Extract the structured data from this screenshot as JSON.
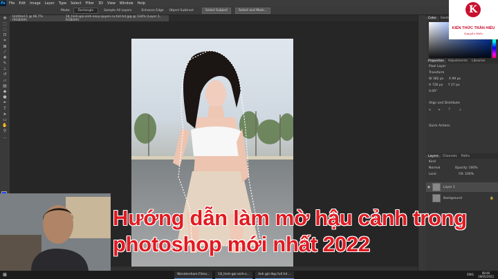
{
  "menubar": {
    "logo": "Ps",
    "items": [
      "File",
      "Edit",
      "Image",
      "Layer",
      "Type",
      "Select",
      "Filter",
      "3D",
      "View",
      "Window",
      "Help"
    ]
  },
  "options": {
    "mode_label": "Mode:",
    "mode_value": "Rectangle",
    "sample_all": "Sample All Layers",
    "enhance_edge": "Enhance Edge",
    "object_subtract": "Object Subtract",
    "select_subject": "Select Subject",
    "select_mask": "Select and Mask..."
  },
  "document": {
    "tab1": "Untitled-1 @ 66.7% (RGB/8#)",
    "tab2": "18_hinh-gai-xinh-sexy-quyen-ru-full-hd.jpg @ 134% (Layer 1, RGB/8#)"
  },
  "panels": {
    "color_tab": "Color",
    "swatches_tab": "Swatches",
    "properties_tab": "Properties",
    "adjustments_tab": "Adjustments",
    "libraries_tab": "Libraries",
    "pixel_layer": "Pixel Layer",
    "transform": "Transform",
    "w_label": "W",
    "w_value": "382 px",
    "h_label": "H",
    "h_value": "726 px",
    "x_label": "X",
    "x_value": "99 px",
    "y_label": "Y",
    "y_value": "27 px",
    "angle": "0.00°",
    "align": "Align and Distribute",
    "quick_actions": "Quick Actions",
    "layers_tab": "Layers",
    "channels_tab": "Channels",
    "paths_tab": "Paths",
    "kind": "Kind",
    "blend": "Normal",
    "opacity": "Opacity: 100%",
    "lock": "Lock:",
    "fill": "Fill: 100%",
    "layer1": "Layer 1",
    "background": "Background"
  },
  "logo": {
    "mark": "K",
    "name": "KIẾN THỨC TRẦN HIẾU",
    "tagline": "Nguyễn Hiếu"
  },
  "headline": {
    "line1": "Hướng dẫn làm mờ hậu cảnh trong",
    "line2": "photoshop mới nhất 2022"
  },
  "taskbar": {
    "app1": "Wondershare Filmo...",
    "app2": "18_hinh-gai-xinh-s...",
    "app3": "ảnh gái đẹp full hd ...",
    "lang": "ENG",
    "time": "08:46",
    "date": "18/05/2022"
  }
}
